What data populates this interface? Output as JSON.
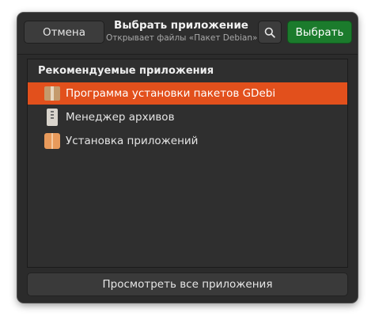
{
  "header": {
    "cancel_label": "Отмена",
    "title": "Выбрать приложение",
    "subtitle": "Открывает файлы «Пакет Debian».",
    "search_icon": "search-icon",
    "select_label": "Выбрать"
  },
  "recommended": {
    "heading": "Рекомендуемые приложения",
    "items": [
      {
        "label": "Программа установки пакетов GDebi",
        "icon": "package-box-icon",
        "selected": true
      },
      {
        "label": "Менеджер архивов",
        "icon": "archive-zip-icon",
        "selected": false
      },
      {
        "label": "Установка приложений",
        "icon": "software-install-icon",
        "selected": false
      }
    ]
  },
  "footer": {
    "show_all_label": "Просмотреть все приложения"
  },
  "colors": {
    "accent_selected": "#e2501c",
    "select_button": "#1b7b2c",
    "window_bg": "#2b2b2b"
  }
}
